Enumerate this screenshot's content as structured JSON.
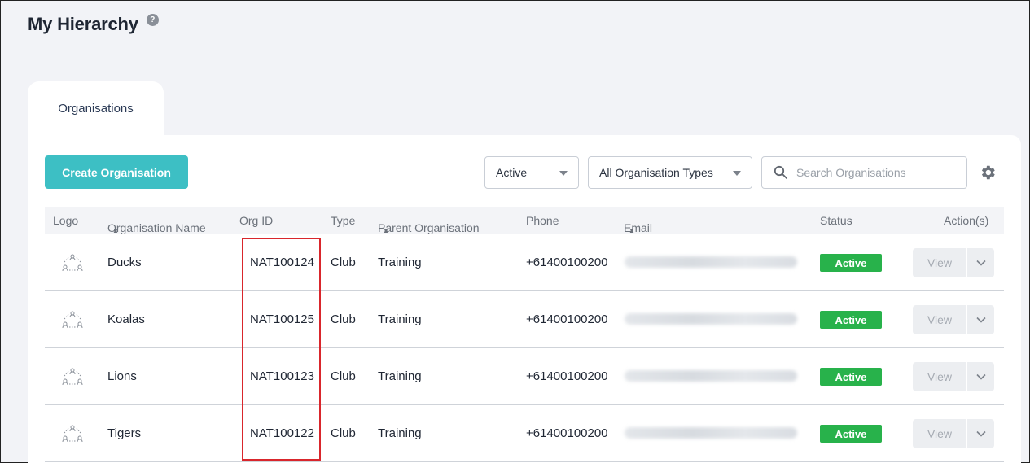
{
  "page": {
    "title": "My Hierarchy",
    "help_symbol": "?"
  },
  "tabs": [
    {
      "label": "Organisations",
      "active": true
    }
  ],
  "toolbar": {
    "create_label": "Create Organisation",
    "status_filter": "Active",
    "type_filter": "All Organisation Types",
    "search_placeholder": "Search Organisations"
  },
  "table": {
    "headers": {
      "logo": "Logo",
      "name": "Organisation Name",
      "org_id": "Org ID",
      "type": "Type",
      "parent": "Parent Organisation",
      "phone": "Phone",
      "email": "Email",
      "status": "Status",
      "actions": "Action(s)"
    },
    "rows": [
      {
        "name": "Ducks",
        "org_id": "NAT100124",
        "type": "Club",
        "parent": "Training",
        "phone": "+61400100200",
        "status": "Active",
        "action": "View"
      },
      {
        "name": "Koalas",
        "org_id": "NAT100125",
        "type": "Club",
        "parent": "Training",
        "phone": "+61400100200",
        "status": "Active",
        "action": "View"
      },
      {
        "name": "Lions",
        "org_id": "NAT100123",
        "type": "Club",
        "parent": "Training",
        "phone": "+61400100200",
        "status": "Active",
        "action": "View"
      },
      {
        "name": "Tigers",
        "org_id": "NAT100122",
        "type": "Club",
        "parent": "Training",
        "phone": "+61400100200",
        "status": "Active",
        "action": "View"
      }
    ]
  },
  "colors": {
    "accent": "#3dbfc4",
    "status_active": "#28b24b",
    "highlight": "#d9262c"
  },
  "icons": {
    "help": "question-circle-icon",
    "search": "search-icon",
    "settings": "gear-icon",
    "logo": "org-network-icon",
    "dropdown": "chevron-down-icon"
  }
}
